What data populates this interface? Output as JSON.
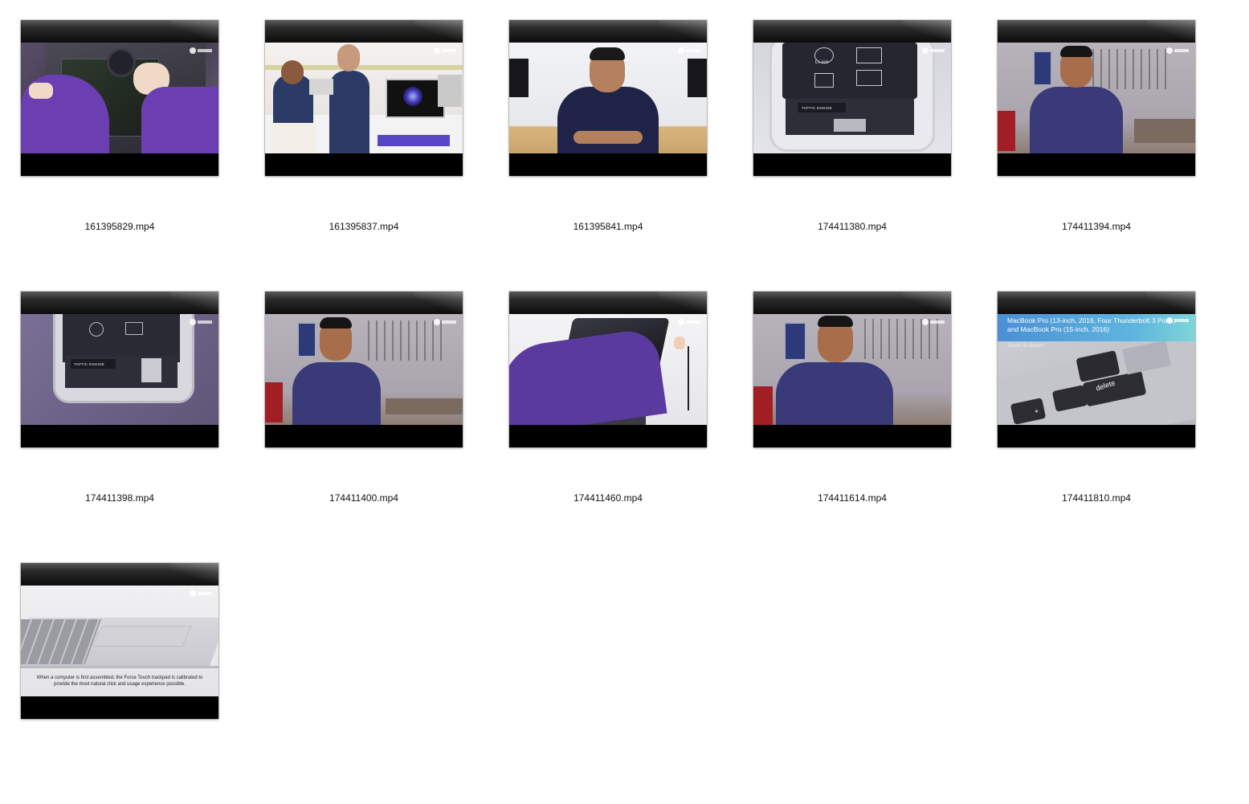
{
  "files": [
    {
      "name": "161395829.mp4",
      "scene": "hands-mainboard"
    },
    {
      "name": "161395837.mp4",
      "scene": "store-people"
    },
    {
      "name": "161395841.mp4",
      "scene": "presenter-hoodie"
    },
    {
      "name": "174411380.mp4",
      "scene": "phone-battery"
    },
    {
      "name": "174411394.mp4",
      "scene": "presenter-pegboard"
    },
    {
      "name": "174411398.mp4",
      "scene": "phone-taptic"
    },
    {
      "name": "174411400.mp4",
      "scene": "presenter-pegboard"
    },
    {
      "name": "174411460.mp4",
      "scene": "display-cable"
    },
    {
      "name": "174411614.mp4",
      "scene": "presenter-pegboard"
    },
    {
      "name": "174411810.mp4",
      "scene": "macbook-keyboard"
    },
    {
      "name": "",
      "scene": "trackpad"
    }
  ],
  "overlays": {
    "battery_label": "Li-ion",
    "taptic_label": "TAPTIC ENGINE",
    "macbook_caption_line1": "MacBook Pro (13-inch, 2016, Four Thunderbolt 3 Ports)",
    "macbook_caption_line2": "and MacBook Pro (15-inch, 2016)",
    "macbook_subcaption": "Touch ID Board",
    "delete_key": "delete",
    "plus_key": "+",
    "trackpad_caption": "When a computer is first assembled, the Force Touch trackpad is calibrated to provide the most natural click and usage experience possible."
  },
  "colors": {
    "background": "#ffffff",
    "filename_text": "#111111",
    "purple_shirt": "#5b3aa0",
    "hoodie": "#1f2347"
  }
}
